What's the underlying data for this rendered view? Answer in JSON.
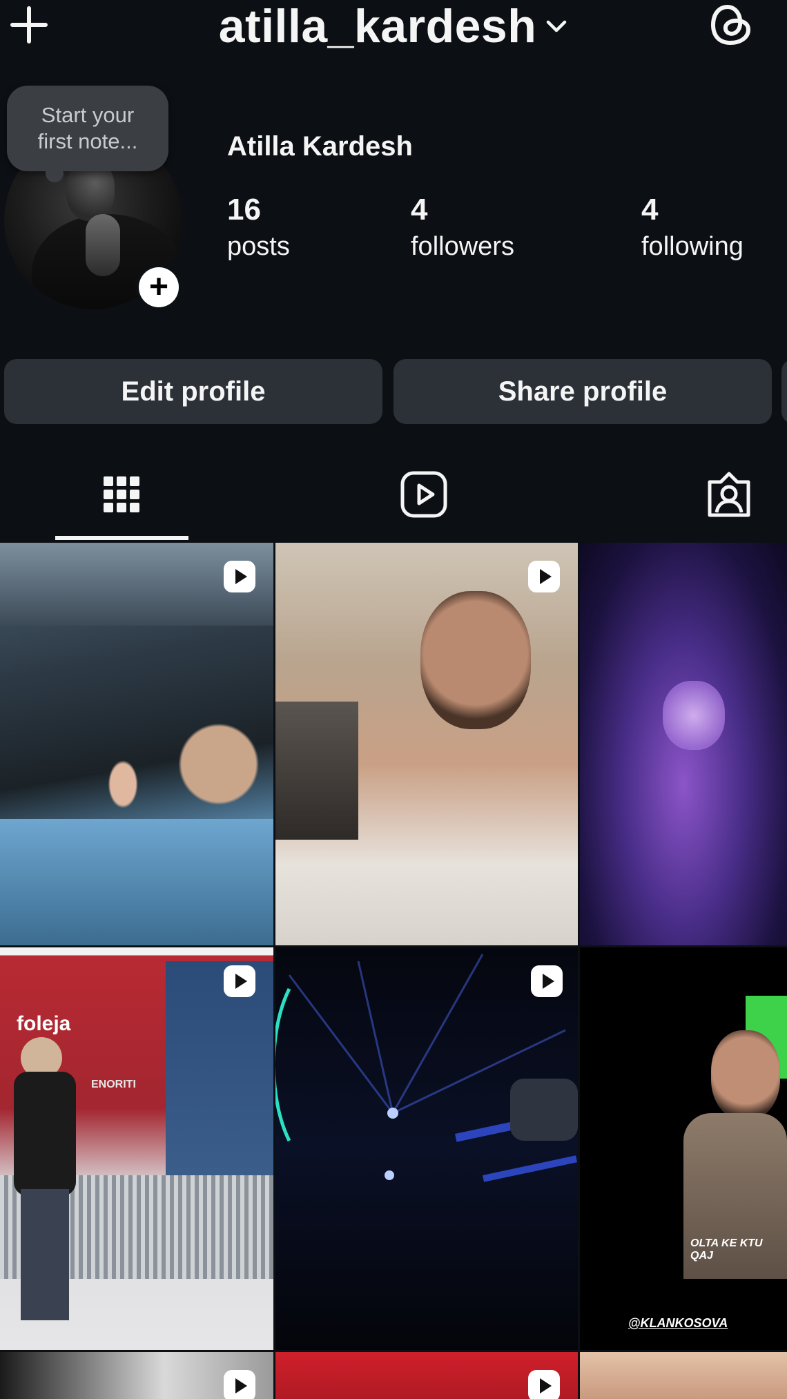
{
  "header": {
    "username": "atilla_kardesh",
    "icons": {
      "create": "plus-icon",
      "account_switcher": "chevron-down-icon",
      "threads": "threads-icon"
    }
  },
  "profile": {
    "full_name": "Atilla Kardesh",
    "note_placeholder": "Start your first note...",
    "stats": {
      "posts": {
        "count": "16",
        "label": "posts"
      },
      "followers": {
        "count": "4",
        "label": "followers"
      },
      "following": {
        "count": "4",
        "label": "following"
      }
    }
  },
  "buttons": {
    "edit": "Edit profile",
    "share": "Share profile"
  },
  "tabs": [
    {
      "name": "grid",
      "icon": "grid-icon",
      "active": true
    },
    {
      "name": "reels",
      "icon": "reels-icon",
      "active": false
    },
    {
      "name": "tagged",
      "icon": "tagged-icon",
      "active": false
    }
  ],
  "grid": {
    "post_texts": {
      "banner_left": "foleja",
      "banner_right": "ENORITI",
      "caption": "OLTA KE KTU QAJ",
      "handle": "@KLANKOSOVA"
    },
    "reel_icon": "reel-play-icon"
  },
  "colors": {
    "background": "#0c1014",
    "button": "#2c3137",
    "note_bubble": "#3b3f44",
    "text": "#f5f5f5"
  }
}
